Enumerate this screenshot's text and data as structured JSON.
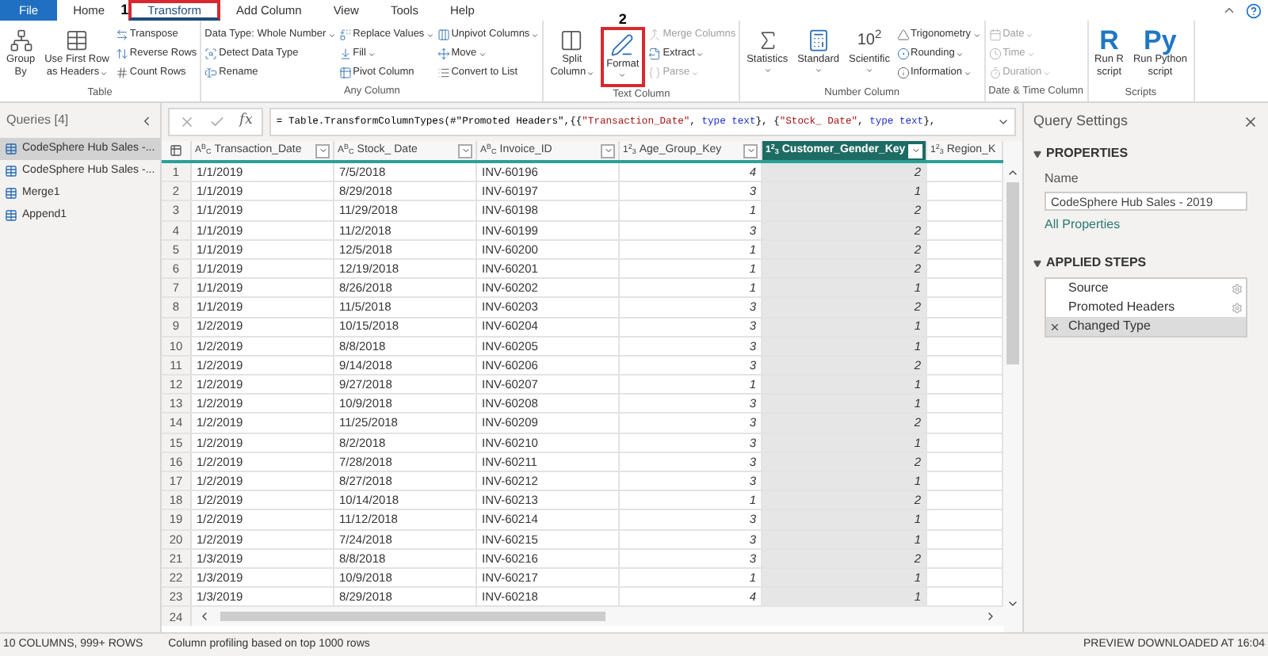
{
  "tabs": [
    {
      "label": "File",
      "kind": "file",
      "selected": false
    },
    {
      "label": "Home",
      "kind": "tab",
      "selected": false
    },
    {
      "label": "Transform",
      "kind": "tab",
      "selected": true,
      "annotation": "1"
    },
    {
      "label": "Add Column",
      "kind": "tab",
      "selected": false
    },
    {
      "label": "View",
      "kind": "tab",
      "selected": false
    },
    {
      "label": "Tools",
      "kind": "tab",
      "selected": false
    },
    {
      "label": "Help",
      "kind": "tab",
      "selected": false
    }
  ],
  "ribbon": {
    "groups": [
      {
        "label": "Table",
        "columns": [
          {
            "items": [
              {
                "kind": "large",
                "lines": [
                  "Group",
                  "By"
                ],
                "dropdown": false,
                "disabled": false
              }
            ]
          },
          {
            "items": [
              {
                "kind": "large",
                "lines": [
                  "Use First Row",
                  "as Headers"
                ],
                "dropdown": true,
                "disabled": false
              }
            ]
          },
          {
            "items": [
              {
                "kind": "small",
                "label": "Transpose",
                "dropdown": false,
                "disabled": false
              },
              {
                "kind": "small",
                "label": "Reverse Rows",
                "dropdown": false,
                "disabled": false
              },
              {
                "kind": "small",
                "label": "Count Rows",
                "dropdown": false,
                "disabled": false
              }
            ]
          }
        ]
      },
      {
        "label": "Any Column",
        "columns": [
          {
            "items": [
              {
                "kind": "small",
                "label": "Data Type: Whole Number",
                "dropdown": true,
                "disabled": false
              },
              {
                "kind": "small",
                "label": "Detect Data Type",
                "dropdown": false,
                "disabled": false
              },
              {
                "kind": "small",
                "label": "Rename",
                "dropdown": false,
                "disabled": false
              }
            ]
          },
          {
            "items": [
              {
                "kind": "small",
                "label": "Replace Values",
                "dropdown": true,
                "disabled": false
              },
              {
                "kind": "small",
                "label": "Fill",
                "dropdown": true,
                "disabled": false
              },
              {
                "kind": "small",
                "label": "Pivot Column",
                "dropdown": false,
                "disabled": false
              }
            ]
          },
          {
            "items": [
              {
                "kind": "small",
                "label": "Unpivot Columns",
                "dropdown": true,
                "disabled": false
              },
              {
                "kind": "small",
                "label": "Move",
                "dropdown": true,
                "disabled": false
              },
              {
                "kind": "small",
                "label": "Convert to List",
                "dropdown": false,
                "disabled": false
              }
            ]
          }
        ]
      },
      {
        "label": "Text Column",
        "columns": [
          {
            "items": [
              {
                "kind": "large",
                "lines": [
                  "Split",
                  "Column"
                ],
                "dropdown": true,
                "disabled": false
              }
            ]
          },
          {
            "items": [
              {
                "kind": "large",
                "lines": [
                  "Format"
                ],
                "dropdown": true,
                "disabled": false,
                "annotation": "2"
              }
            ]
          },
          {
            "items": [
              {
                "kind": "small",
                "label": "Merge Columns",
                "dropdown": false,
                "disabled": true
              },
              {
                "kind": "small",
                "label": "Extract",
                "dropdown": true,
                "disabled": false
              },
              {
                "kind": "small",
                "label": "Parse",
                "dropdown": true,
                "disabled": true
              }
            ]
          }
        ]
      },
      {
        "label": "Number Column",
        "columns": [
          {
            "items": [
              {
                "kind": "large",
                "lines": [
                  "Statistics"
                ],
                "dropdown": true,
                "disabled": false
              }
            ]
          },
          {
            "items": [
              {
                "kind": "large",
                "lines": [
                  "Standard"
                ],
                "dropdown": true,
                "disabled": false
              }
            ]
          },
          {
            "items": [
              {
                "kind": "large",
                "lines": [
                  "Scientific"
                ],
                "glyph": "10$^{2}$",
                "dropdown": true,
                "disabled": false
              }
            ]
          },
          {
            "items": [
              {
                "kind": "small",
                "label": "Trigonometry",
                "dropdown": true,
                "disabled": false
              },
              {
                "kind": "small",
                "label": "Rounding",
                "dropdown": true,
                "disabled": false
              },
              {
                "kind": "small",
                "label": "Information",
                "dropdown": true,
                "disabled": false
              }
            ]
          }
        ]
      },
      {
        "label": "Date & Time Column",
        "columns": [
          {
            "items": [
              {
                "kind": "small",
                "label": "Date",
                "dropdown": true,
                "disabled": true
              },
              {
                "kind": "small",
                "label": "Time",
                "dropdown": true,
                "disabled": true
              },
              {
                "kind": "small",
                "label": "Duration",
                "dropdown": true,
                "disabled": true
              }
            ]
          }
        ]
      },
      {
        "label": "Scripts",
        "columns": [
          {
            "items": [
              {
                "kind": "large",
                "lines": [
                  "Run R",
                  "script"
                ],
                "glyph": "R",
                "dropdown": false,
                "disabled": false
              }
            ]
          },
          {
            "items": [
              {
                "kind": "large",
                "lines": [
                  "Run Python",
                  "script"
                ],
                "glyph": "Py",
                "dropdown": false,
                "disabled": false
              }
            ]
          }
        ]
      }
    ]
  },
  "queries": {
    "title": "Queries [4]",
    "items": [
      {
        "label": "CodeSphere Hub Sales -...",
        "selected": true
      },
      {
        "label": "CodeSphere Hub Sales -...",
        "selected": false
      },
      {
        "label": "Merge1",
        "selected": false
      },
      {
        "label": "Append1",
        "selected": false
      }
    ]
  },
  "formula_bar": {
    "function_label": "fx",
    "segments": [
      {
        "text": "= Table.TransformColumnTypes(#\"Promoted Headers\",{{",
        "kind": "plain"
      },
      {
        "text": "\"Transaction_Date\"",
        "kind": "string"
      },
      {
        "text": ", ",
        "kind": "plain"
      },
      {
        "text": "type text",
        "kind": "keyword"
      },
      {
        "text": "}, {",
        "kind": "plain"
      },
      {
        "text": "\"Stock_ Date\"",
        "kind": "string"
      },
      {
        "text": ", ",
        "kind": "plain"
      },
      {
        "text": "type text",
        "kind": "keyword"
      },
      {
        "text": "},",
        "kind": "plain"
      }
    ]
  },
  "table": {
    "columns": [
      {
        "name": "Transaction_Date",
        "type_glyph": "A$^{B}$$_{C}$",
        "kind": "text",
        "selected": false
      },
      {
        "name": "Stock_ Date",
        "type_glyph": "A$^{B}$$_{C}$",
        "kind": "text",
        "selected": false
      },
      {
        "name": "Invoice_ID",
        "type_glyph": "A$^{B}$$_{C}$",
        "kind": "text",
        "selected": false
      },
      {
        "name": "Age_Group_Key",
        "type_glyph": "1$^{2}$$_{3}$",
        "kind": "number",
        "selected": false
      },
      {
        "name": "Customer_Gender_Key",
        "type_glyph": "1$^{2}$$_{3}$",
        "kind": "number",
        "selected": true
      },
      {
        "name": "Region_K",
        "type_glyph": "1$^{2}$$_{3}$",
        "kind": "number",
        "selected": false
      }
    ],
    "rows": [
      {
        "n": "1",
        "cells": [
          "1/1/2019",
          "7/5/2018",
          "INV-60196",
          "4",
          "2"
        ]
      },
      {
        "n": "2",
        "cells": [
          "1/1/2019",
          "8/29/2018",
          "INV-60197",
          "3",
          "1"
        ]
      },
      {
        "n": "3",
        "cells": [
          "1/1/2019",
          "11/29/2018",
          "INV-60198",
          "1",
          "2"
        ]
      },
      {
        "n": "4",
        "cells": [
          "1/1/2019",
          "11/2/2018",
          "INV-60199",
          "3",
          "2"
        ]
      },
      {
        "n": "5",
        "cells": [
          "1/1/2019",
          "12/5/2018",
          "INV-60200",
          "1",
          "2"
        ]
      },
      {
        "n": "6",
        "cells": [
          "1/1/2019",
          "12/19/2018",
          "INV-60201",
          "1",
          "2"
        ]
      },
      {
        "n": "7",
        "cells": [
          "1/1/2019",
          "8/26/2018",
          "INV-60202",
          "1",
          "1"
        ]
      },
      {
        "n": "8",
        "cells": [
          "1/1/2019",
          "11/5/2018",
          "INV-60203",
          "3",
          "2"
        ]
      },
      {
        "n": "9",
        "cells": [
          "1/2/2019",
          "10/15/2018",
          "INV-60204",
          "3",
          "1"
        ]
      },
      {
        "n": "10",
        "cells": [
          "1/2/2019",
          "8/8/2018",
          "INV-60205",
          "3",
          "1"
        ]
      },
      {
        "n": "11",
        "cells": [
          "1/2/2019",
          "9/14/2018",
          "INV-60206",
          "3",
          "2"
        ]
      },
      {
        "n": "12",
        "cells": [
          "1/2/2019",
          "9/27/2018",
          "INV-60207",
          "1",
          "1"
        ]
      },
      {
        "n": "13",
        "cells": [
          "1/2/2019",
          "10/9/2018",
          "INV-60208",
          "3",
          "1"
        ]
      },
      {
        "n": "14",
        "cells": [
          "1/2/2019",
          "11/25/2018",
          "INV-60209",
          "3",
          "2"
        ]
      },
      {
        "n": "15",
        "cells": [
          "1/2/2019",
          "8/2/2018",
          "INV-60210",
          "3",
          "1"
        ]
      },
      {
        "n": "16",
        "cells": [
          "1/2/2019",
          "7/28/2018",
          "INV-60211",
          "3",
          "2"
        ]
      },
      {
        "n": "17",
        "cells": [
          "1/2/2019",
          "8/27/2018",
          "INV-60212",
          "3",
          "1"
        ]
      },
      {
        "n": "18",
        "cells": [
          "1/2/2019",
          "10/14/2018",
          "INV-60213",
          "1",
          "2"
        ]
      },
      {
        "n": "19",
        "cells": [
          "1/2/2019",
          "11/12/2018",
          "INV-60214",
          "3",
          "1"
        ]
      },
      {
        "n": "20",
        "cells": [
          "1/2/2019",
          "7/24/2018",
          "INV-60215",
          "3",
          "1"
        ]
      },
      {
        "n": "21",
        "cells": [
          "1/3/2019",
          "8/8/2018",
          "INV-60216",
          "3",
          "2"
        ]
      },
      {
        "n": "22",
        "cells": [
          "1/3/2019",
          "10/9/2018",
          "INV-60217",
          "1",
          "1"
        ]
      },
      {
        "n": "23",
        "cells": [
          "1/3/2019",
          "8/29/2018",
          "INV-60218",
          "4",
          "1"
        ]
      }
    ],
    "last_row_number": "24"
  },
  "query_settings": {
    "title": "Query Settings",
    "properties_heading": "PROPERTIES",
    "name_label": "Name",
    "name_value": "CodeSphere Hub Sales - 2019",
    "all_properties_link": "All Properties",
    "steps_heading": "APPLIED STEPS",
    "steps": [
      {
        "label": "Source",
        "settings": true,
        "selected": false
      },
      {
        "label": "Promoted Headers",
        "settings": true,
        "selected": false
      },
      {
        "label": "Changed Type",
        "settings": false,
        "selected": true
      }
    ]
  },
  "status_bar": {
    "summary": "10 COLUMNS, 999+ ROWS",
    "profiling": "Column profiling based on top 1000 rows",
    "preview": "PREVIEW DOWNLOADED AT 16:04"
  }
}
